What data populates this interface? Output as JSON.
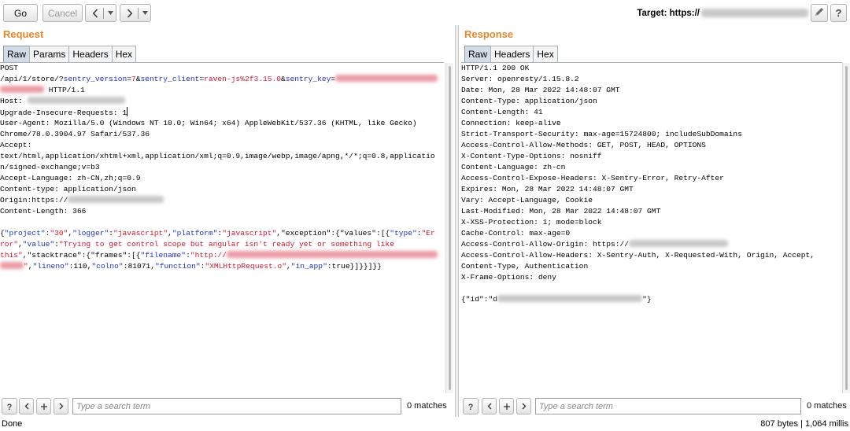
{
  "toolbar": {
    "go": "Go",
    "cancel": "Cancel",
    "target": "Target: https://"
  },
  "request": {
    "title": "Request",
    "tabs": [
      {
        "label": "Raw",
        "selected": true
      },
      {
        "label": "Params",
        "selected": false
      },
      {
        "label": "Headers",
        "selected": false
      },
      {
        "label": "Hex",
        "selected": false
      }
    ],
    "lines": [
      [
        {
          "t": "POST",
          "s": "p"
        }
      ],
      [
        {
          "t": "/api/1/store/?",
          "s": "p"
        },
        {
          "t": "sentry_version",
          "s": "k"
        },
        {
          "t": "=",
          "s": "p"
        },
        {
          "t": "7",
          "s": "v"
        },
        {
          "t": "&",
          "s": "p"
        },
        {
          "t": "sentry_client",
          "s": "k"
        },
        {
          "t": "=",
          "s": "p"
        },
        {
          "t": "raven-js%2f3.15.0",
          "s": "v"
        },
        {
          "t": "&",
          "s": "p"
        },
        {
          "t": "sentry_key",
          "s": "k"
        },
        {
          "t": "=",
          "s": "p"
        },
        {
          "mask": "req-sentry-key",
          "tone": "v"
        }
      ],
      [
        {
          "mask": "req-sentry-key-tail",
          "tone": "v"
        },
        {
          "t": " HTTP/1.1",
          "s": "p"
        }
      ],
      [
        {
          "t": "Host: ",
          "s": "p"
        },
        {
          "mask": "req-host",
          "tone": "p"
        }
      ],
      [
        {
          "t": "Upgrade-Insecure-Requests: 1",
          "s": "p"
        },
        {
          "caret": true
        }
      ],
      [
        {
          "t": "User-Agent: Mozilla/5.0 (Windows NT 10.0; Win64; x64) AppleWebKit/537.36 (KHTML, like Gecko)",
          "s": "p"
        }
      ],
      [
        {
          "t": "Chrome/78.0.3904.97 Safari/537.36",
          "s": "p"
        }
      ],
      [
        {
          "t": "Accept:",
          "s": "p"
        }
      ],
      [
        {
          "t": "text/html,application/xhtml+xml,application/xml;q=0.9,image/webp,image/apng,*/*;q=0.8,applicatio",
          "s": "p"
        }
      ],
      [
        {
          "t": "n/signed-exchange;v=b3",
          "s": "p"
        }
      ],
      [
        {
          "t": "Accept-Language: zh-CN,zh;q=0.9",
          "s": "p"
        }
      ],
      [
        {
          "t": "Content-type: application/json",
          "s": "p"
        }
      ],
      [
        {
          "t": "Origin:https://",
          "s": "p"
        },
        {
          "mask": "req-origin",
          "tone": "p"
        }
      ],
      [
        {
          "t": "Content-Length: 366",
          "s": "p"
        }
      ],
      [],
      [
        {
          "t": "{",
          "s": "p"
        },
        {
          "t": "\"project\"",
          "s": "k"
        },
        {
          "t": ":",
          "s": "p"
        },
        {
          "t": "\"30\"",
          "s": "v"
        },
        {
          "t": ",",
          "s": "p"
        },
        {
          "t": "\"logger\"",
          "s": "k"
        },
        {
          "t": ":",
          "s": "p"
        },
        {
          "t": "\"javascript\"",
          "s": "v"
        },
        {
          "t": ",",
          "s": "p"
        },
        {
          "t": "\"platform\"",
          "s": "k"
        },
        {
          "t": ":",
          "s": "p"
        },
        {
          "t": "\"javascript\"",
          "s": "v"
        },
        {
          "t": ",\"exception\":{\"values\":[{",
          "s": "p"
        },
        {
          "t": "\"type\"",
          "s": "k"
        },
        {
          "t": ":",
          "s": "p"
        },
        {
          "t": "\"Er",
          "s": "v"
        }
      ],
      [
        {
          "t": "ror\"",
          "s": "v"
        },
        {
          "t": ",",
          "s": "p"
        },
        {
          "t": "\"value\"",
          "s": "k"
        },
        {
          "t": ":",
          "s": "p"
        },
        {
          "t": "\"Trying to get control scope but angular isn't ready yet or something like",
          "s": "v"
        }
      ],
      [
        {
          "t": "this\"",
          "s": "v"
        },
        {
          "t": ",\"stacktrace\":{\"frames\":[{",
          "s": "p"
        },
        {
          "t": "\"filename\"",
          "s": "k"
        },
        {
          "t": ":",
          "s": "p"
        },
        {
          "t": "\"http://",
          "s": "v"
        },
        {
          "mask": "req-filename",
          "tone": "v"
        }
      ],
      [
        {
          "mask": "req-filename-tail",
          "tone": "v"
        },
        {
          "t": "\"",
          "s": "v"
        },
        {
          "t": ",",
          "s": "p"
        },
        {
          "t": "\"lineno\"",
          "s": "k"
        },
        {
          "t": ":110,",
          "s": "p"
        },
        {
          "t": "\"colno\"",
          "s": "k"
        },
        {
          "t": ":81071,",
          "s": "p"
        },
        {
          "t": "\"function\"",
          "s": "k"
        },
        {
          "t": ":",
          "s": "p"
        },
        {
          "t": "\"XMLHttpRequest.o\"",
          "s": "v"
        },
        {
          "t": ",",
          "s": "p"
        },
        {
          "t": "\"in_app\"",
          "s": "k"
        },
        {
          "t": ":true}]}}]}}",
          "s": "p"
        }
      ]
    ],
    "search": {
      "placeholder": "Type a search term",
      "matches": "0 matches"
    }
  },
  "response": {
    "title": "Response",
    "tabs": [
      {
        "label": "Raw",
        "selected": true
      },
      {
        "label": "Headers",
        "selected": false
      },
      {
        "label": "Hex",
        "selected": false
      }
    ],
    "lines": [
      [
        {
          "t": "HTTP/1.1 200 OK",
          "s": "p"
        }
      ],
      [
        {
          "t": "Server: openresty/1.15.8.2",
          "s": "p"
        }
      ],
      [
        {
          "t": "Date: Mon, 28 Mar 2022 14:48:07 GMT",
          "s": "p"
        }
      ],
      [
        {
          "t": "Content-Type: application/json",
          "s": "p"
        }
      ],
      [
        {
          "t": "Content-Length: 41",
          "s": "p"
        }
      ],
      [
        {
          "t": "Connection: keep-alive",
          "s": "p"
        }
      ],
      [
        {
          "t": "Strict-Transport-Security: max-age=15724800; includeSubDomains",
          "s": "p"
        }
      ],
      [
        {
          "t": "Access-Control-Allow-Methods: GET, POST, HEAD, OPTIONS",
          "s": "p"
        }
      ],
      [
        {
          "t": "X-Content-Type-Options: nosniff",
          "s": "p"
        }
      ],
      [
        {
          "t": "Content-Language: zh-cn",
          "s": "p"
        }
      ],
      [
        {
          "t": "Access-Control-Expose-Headers: X-Sentry-Error, Retry-After",
          "s": "p"
        }
      ],
      [
        {
          "t": "Expires: Mon, 28 Mar 2022 14:48:07 GMT",
          "s": "p"
        }
      ],
      [
        {
          "t": "Vary: Accept-Language, Cookie",
          "s": "p"
        }
      ],
      [
        {
          "t": "Last-Modified: Mon, 28 Mar 2022 14:48:07 GMT",
          "s": "p"
        }
      ],
      [
        {
          "t": "X-XSS-Protection: 1; mode=block",
          "s": "p"
        }
      ],
      [
        {
          "t": "Cache-Control: max-age=0",
          "s": "p"
        }
      ],
      [
        {
          "t": "Access-Control-Allow-Origin: https://",
          "s": "p"
        },
        {
          "mask": "res-origin",
          "tone": "p"
        }
      ],
      [
        {
          "t": "Access-Control-Allow-Headers: X-Sentry-Auth, X-Requested-With, Origin, Accept,",
          "s": "p"
        }
      ],
      [
        {
          "t": "Content-Type, Authentication",
          "s": "p"
        }
      ],
      [
        {
          "t": "X-Frame-Options: deny",
          "s": "p"
        }
      ],
      [],
      [
        {
          "t": "{\"id\":\"d",
          "s": "p"
        },
        {
          "mask": "res-id",
          "tone": "p"
        },
        {
          "t": "\"}",
          "s": "p"
        }
      ]
    ],
    "search": {
      "placeholder": "Type a search term",
      "matches": "0 matches"
    }
  },
  "status": {
    "left": "Done",
    "right": "807 bytes | 1,064 millis"
  },
  "icons": {
    "history_back": "chevron-left-icon",
    "history_forward": "chevron-right-icon",
    "history_menu": "dropdown-arrow-icon",
    "edit_target": "pencil-icon",
    "help": "help-icon",
    "search_prev": "chevron-left-icon",
    "search_add": "plus-icon",
    "search_next": "chevron-right-icon"
  },
  "colors": {
    "section_title": "#e8862d",
    "param_name": "#2130c8",
    "param_value": "#d2162e",
    "selected_tab": "#d3dbe5"
  }
}
